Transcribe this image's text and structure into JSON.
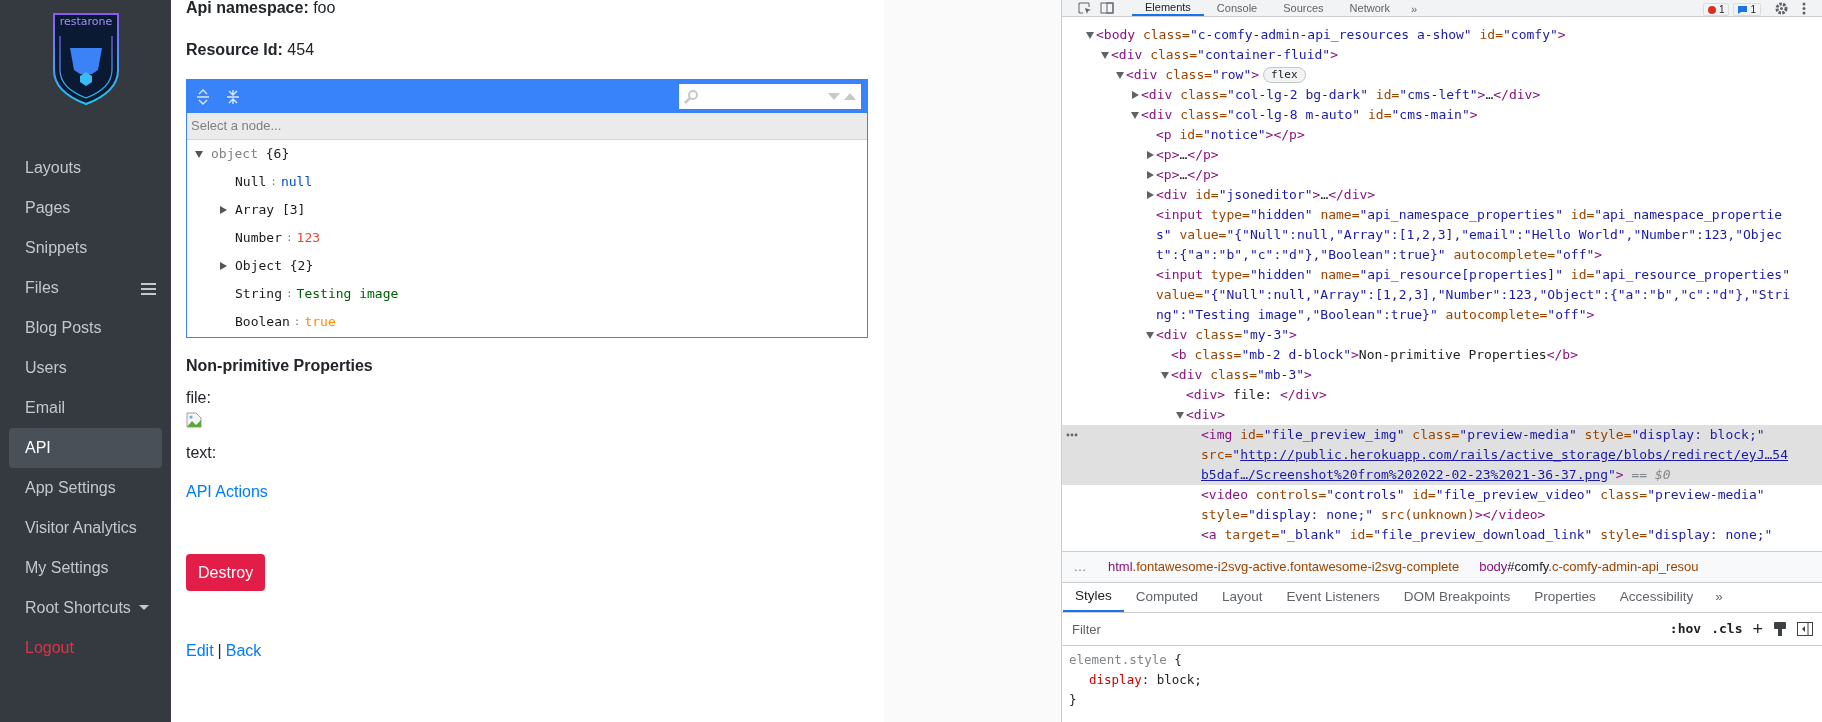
{
  "sidebar": {
    "logo_text": "restarone",
    "items": [
      {
        "label": "Layouts",
        "kind": "link",
        "selected": false
      },
      {
        "label": "Pages",
        "kind": "link",
        "selected": false
      },
      {
        "label": "Snippets",
        "kind": "link",
        "selected": false
      },
      {
        "label": "Files",
        "kind": "menu",
        "selected": false
      },
      {
        "label": "Blog Posts",
        "kind": "link",
        "selected": false
      },
      {
        "label": "Users",
        "kind": "link",
        "selected": false
      },
      {
        "label": "Email",
        "kind": "link",
        "selected": false
      },
      {
        "label": "API",
        "kind": "link",
        "selected": true
      },
      {
        "label": "App Settings",
        "kind": "link",
        "selected": false
      },
      {
        "label": "Visitor Analytics",
        "kind": "link",
        "selected": false
      },
      {
        "label": "My Settings",
        "kind": "link",
        "selected": false
      },
      {
        "label": "Root Shortcuts",
        "kind": "dropdown",
        "selected": false
      },
      {
        "label": "Logout",
        "kind": "danger",
        "selected": false
      }
    ]
  },
  "fields": [
    {
      "label": "Api namespace:",
      "value": "foo"
    },
    {
      "label": "Resource Id:",
      "value": "454"
    }
  ],
  "json_editor": {
    "navigation_text": "Select a node...",
    "separator": ":",
    "root": {
      "label": "object",
      "count": "{6}",
      "expanded": true
    },
    "nodes": [
      {
        "key": "Null",
        "kind": "null",
        "value": "null"
      },
      {
        "key": "Array",
        "kind": "array",
        "count": "[3]",
        "expanded": false
      },
      {
        "key": "Number",
        "kind": "number",
        "value": "123"
      },
      {
        "key": "Object",
        "kind": "object",
        "count": "{2}",
        "expanded": false
      },
      {
        "key": "String",
        "kind": "string",
        "value": "Testing image"
      },
      {
        "key": "Boolean",
        "kind": "boolean",
        "value": "true"
      }
    ]
  },
  "non_primitive": {
    "title": "Non-primitive Properties",
    "items": [
      {
        "label": "file:",
        "kind": "image"
      },
      {
        "label": "text:",
        "kind": "text"
      }
    ]
  },
  "actions_link": "API Actions",
  "destroy_button": "Destroy",
  "footer_links": [
    "Edit",
    "Back"
  ],
  "footer_separator": "|",
  "devtools": {
    "tabs": [
      {
        "label": "Elements",
        "selected": true
      },
      {
        "label": "Console",
        "selected": false
      },
      {
        "label": "Sources",
        "selected": false
      },
      {
        "label": "Network",
        "selected": false
      }
    ],
    "more_tabs": "»",
    "error_count": "1",
    "message_count": "1",
    "dom": [
      {
        "expanded": true,
        "selected": false,
        "lines": [
          [
            {
              "kind": "tag",
              "text": "<body"
            },
            {
              "kind": "attr",
              "text": " class="
            },
            {
              "kind": "val",
              "text": "\"c-comfy-admin-api_resources a-show\""
            },
            {
              "kind": "attr",
              "text": " id="
            },
            {
              "kind": "val",
              "text": "\"comfy\""
            },
            {
              "kind": "tag",
              "text": ">"
            }
          ]
        ],
        "children": [
          {
            "expanded": true,
            "selected": false,
            "lines": [
              [
                {
                  "kind": "tag",
                  "text": "<div"
                },
                {
                  "kind": "attr",
                  "text": " class="
                },
                {
                  "kind": "val",
                  "text": "\"container-fluid\""
                },
                {
                  "kind": "tag",
                  "text": ">"
                }
              ]
            ],
            "children": [
              {
                "expanded": true,
                "selected": false,
                "badge": "flex",
                "lines": [
                  [
                    {
                      "kind": "tag",
                      "text": "<div"
                    },
                    {
                      "kind": "attr",
                      "text": " class="
                    },
                    {
                      "kind": "val",
                      "text": "\"row\""
                    },
                    {
                      "kind": "tag",
                      "text": ">"
                    }
                  ]
                ],
                "children": [
                  {
                    "expanded": false,
                    "selected": false,
                    "lines": [
                      [
                        {
                          "kind": "tag",
                          "text": "<div"
                        },
                        {
                          "kind": "attr",
                          "text": " class="
                        },
                        {
                          "kind": "val",
                          "text": "\"col-lg-2 bg-dark\""
                        },
                        {
                          "kind": "attr",
                          "text": " id="
                        },
                        {
                          "kind": "val",
                          "text": "\"cms-left\""
                        },
                        {
                          "kind": "tag",
                          "text": ">"
                        },
                        {
                          "kind": "text",
                          "text": "…"
                        },
                        {
                          "kind": "tag",
                          "text": "</div>"
                        }
                      ]
                    ]
                  },
                  {
                    "expanded": true,
                    "selected": false,
                    "lines": [
                      [
                        {
                          "kind": "tag",
                          "text": "<div"
                        },
                        {
                          "kind": "attr",
                          "text": " class="
                        },
                        {
                          "kind": "val",
                          "text": "\"col-lg-8 m-auto\""
                        },
                        {
                          "kind": "attr",
                          "text": " id="
                        },
                        {
                          "kind": "val",
                          "text": "\"cms-main\""
                        },
                        {
                          "kind": "tag",
                          "text": ">"
                        }
                      ]
                    ],
                    "children": [
                      {
                        "selected": false,
                        "lines": [
                          [
                            {
                              "kind": "tag",
                              "text": "<p"
                            },
                            {
                              "kind": "attr",
                              "text": " id="
                            },
                            {
                              "kind": "val",
                              "text": "\"notice\""
                            },
                            {
                              "kind": "tag",
                              "text": "></p>"
                            }
                          ]
                        ]
                      },
                      {
                        "expanded": false,
                        "selected": false,
                        "lines": [
                          [
                            {
                              "kind": "tag",
                              "text": "<p>"
                            },
                            {
                              "kind": "text",
                              "text": "…"
                            },
                            {
                              "kind": "tag",
                              "text": "</p>"
                            }
                          ]
                        ]
                      },
                      {
                        "expanded": false,
                        "selected": false,
                        "lines": [
                          [
                            {
                              "kind": "tag",
                              "text": "<p>"
                            },
                            {
                              "kind": "text",
                              "text": "…"
                            },
                            {
                              "kind": "tag",
                              "text": "</p>"
                            }
                          ]
                        ]
                      },
                      {
                        "expanded": false,
                        "selected": false,
                        "lines": [
                          [
                            {
                              "kind": "tag",
                              "text": "<div"
                            },
                            {
                              "kind": "attr",
                              "text": " id="
                            },
                            {
                              "kind": "val",
                              "text": "\"jsoneditor\""
                            },
                            {
                              "kind": "tag",
                              "text": ">"
                            },
                            {
                              "kind": "text",
                              "text": "…"
                            },
                            {
                              "kind": "tag",
                              "text": "</div>"
                            }
                          ]
                        ]
                      },
                      {
                        "selected": false,
                        "lines": [
                          [
                            {
                              "kind": "tag",
                              "text": "<input"
                            },
                            {
                              "kind": "attr",
                              "text": " type="
                            },
                            {
                              "kind": "val",
                              "text": "\"hidden\""
                            },
                            {
                              "kind": "attr",
                              "text": " name="
                            },
                            {
                              "kind": "val",
                              "text": "\"api_namespace_properties\""
                            },
                            {
                              "kind": "attr",
                              "text": " id="
                            },
                            {
                              "kind": "val",
                              "text": "\"api_namespace_propertie"
                            }
                          ],
                          [
                            {
                              "kind": "val",
                              "text": "s\""
                            },
                            {
                              "kind": "attr",
                              "text": " value="
                            },
                            {
                              "kind": "val",
                              "text": "\"{\"Null\":null,\"Array\":[1,2,3],\"email\":\"Hello World\",\"Number\":123,\"Objec"
                            }
                          ],
                          [
                            {
                              "kind": "val",
                              "text": "t\":{\"a\":\"b\",\"c\":\"d\"},\"Boolean\":true}\""
                            },
                            {
                              "kind": "attr",
                              "text": " autocomplete="
                            },
                            {
                              "kind": "val",
                              "text": "\"off\""
                            },
                            {
                              "kind": "tag",
                              "text": ">"
                            }
                          ]
                        ]
                      },
                      {
                        "selected": false,
                        "lines": [
                          [
                            {
                              "kind": "tag",
                              "text": "<input"
                            },
                            {
                              "kind": "attr",
                              "text": " type="
                            },
                            {
                              "kind": "val",
                              "text": "\"hidden\""
                            },
                            {
                              "kind": "attr",
                              "text": " name="
                            },
                            {
                              "kind": "val",
                              "text": "\"api_resource[properties]\""
                            },
                            {
                              "kind": "attr",
                              "text": " id="
                            },
                            {
                              "kind": "val",
                              "text": "\"api_resource_properties\""
                            }
                          ],
                          [
                            {
                              "kind": "attr",
                              "text": "value="
                            },
                            {
                              "kind": "val",
                              "text": "\"{\"Null\":null,\"Array\":[1,2,3],\"Number\":123,\"Object\":{\"a\":\"b\",\"c\":\"d\"},\"Stri"
                            }
                          ],
                          [
                            {
                              "kind": "val",
                              "text": "ng\":\"Testing image\",\"Boolean\":true}\""
                            },
                            {
                              "kind": "attr",
                              "text": " autocomplete="
                            },
                            {
                              "kind": "val",
                              "text": "\"off\""
                            },
                            {
                              "kind": "tag",
                              "text": ">"
                            }
                          ]
                        ]
                      },
                      {
                        "expanded": true,
                        "selected": false,
                        "lines": [
                          [
                            {
                              "kind": "tag",
                              "text": "<div"
                            },
                            {
                              "kind": "attr",
                              "text": " class="
                            },
                            {
                              "kind": "val",
                              "text": "\"my-3\""
                            },
                            {
                              "kind": "tag",
                              "text": ">"
                            }
                          ]
                        ],
                        "children": [
                          {
                            "selected": false,
                            "lines": [
                              [
                                {
                                  "kind": "tag",
                                  "text": "<b"
                                },
                                {
                                  "kind": "attr",
                                  "text": " class="
                                },
                                {
                                  "kind": "val",
                                  "text": "\"mb-2 d-block\""
                                },
                                {
                                  "kind": "tag",
                                  "text": ">"
                                },
                                {
                                  "kind": "text",
                                  "text": "Non-primitive Properties"
                                },
                                {
                                  "kind": "tag",
                                  "text": "</b>"
                                }
                              ]
                            ]
                          },
                          {
                            "expanded": true,
                            "selected": false,
                            "lines": [
                              [
                                {
                                  "kind": "tag",
                                  "text": "<div"
                                },
                                {
                                  "kind": "attr",
                                  "text": " class="
                                },
                                {
                                  "kind": "val",
                                  "text": "\"mb-3\""
                                },
                                {
                                  "kind": "tag",
                                  "text": ">"
                                }
                              ]
                            ],
                            "children": [
                              {
                                "selected": false,
                                "lines": [
                                  [
                                    {
                                      "kind": "tag",
                                      "text": "<div>"
                                    },
                                    {
                                      "kind": "text",
                                      "text": " file: "
                                    },
                                    {
                                      "kind": "tag",
                                      "text": "</div>"
                                    }
                                  ]
                                ]
                              },
                              {
                                "expanded": true,
                                "selected": false,
                                "lines": [
                                  [
                                    {
                                      "kind": "tag",
                                      "text": "<div>"
                                    }
                                  ]
                                ],
                                "children": [
                                  {
                                    "selected": true,
                                    "lines": [
                                      [
                                        {
                                          "kind": "tag",
                                          "text": "<img"
                                        },
                                        {
                                          "kind": "attr",
                                          "text": " id="
                                        },
                                        {
                                          "kind": "val",
                                          "text": "\"file_preview_img\""
                                        },
                                        {
                                          "kind": "attr",
                                          "text": " class="
                                        },
                                        {
                                          "kind": "val",
                                          "text": "\"preview-media\""
                                        },
                                        {
                                          "kind": "attr",
                                          "text": " style="
                                        },
                                        {
                                          "kind": "val",
                                          "text": "\"display: block;\""
                                        }
                                      ],
                                      [
                                        {
                                          "kind": "attr",
                                          "text": "src="
                                        },
                                        {
                                          "kind": "val",
                                          "text": "\""
                                        },
                                        {
                                          "kind": "link",
                                          "text": "http://public.herokuapp.com/rails/active_storage/blobs/redirect/eyJ…54"
                                        }
                                      ],
                                      [
                                        {
                                          "kind": "link",
                                          "text": "b5daf…/Screenshot%20from%202022-02-23%2021-36-37.png"
                                        },
                                        {
                                          "kind": "val",
                                          "text": "\""
                                        },
                                        {
                                          "kind": "tag",
                                          "text": ">"
                                        },
                                        {
                                          "kind": "dim",
                                          "text": " == $0"
                                        }
                                      ]
                                    ]
                                  },
                                  {
                                    "selected": false,
                                    "lines": [
                                      [
                                        {
                                          "kind": "tag",
                                          "text": "<video"
                                        },
                                        {
                                          "kind": "attr",
                                          "text": " controls="
                                        },
                                        {
                                          "kind": "val",
                                          "text": "\"controls\""
                                        },
                                        {
                                          "kind": "attr",
                                          "text": " id="
                                        },
                                        {
                                          "kind": "val",
                                          "text": "\"file_preview_video\""
                                        },
                                        {
                                          "kind": "attr",
                                          "text": " class="
                                        },
                                        {
                                          "kind": "val",
                                          "text": "\"preview-media\""
                                        }
                                      ],
                                      [
                                        {
                                          "kind": "attr",
                                          "text": "style="
                                        },
                                        {
                                          "kind": "val",
                                          "text": "\"display: none;\""
                                        },
                                        {
                                          "kind": "attr",
                                          "text": " src(unknown)"
                                        },
                                        {
                                          "kind": "tag",
                                          "text": "></video>"
                                        }
                                      ]
                                    ]
                                  },
                                  {
                                    "selected": false,
                                    "lines": [
                                      [
                                        {
                                          "kind": "tag",
                                          "text": "<a"
                                        },
                                        {
                                          "kind": "attr",
                                          "text": " target="
                                        },
                                        {
                                          "kind": "val",
                                          "text": "\"_blank\""
                                        },
                                        {
                                          "kind": "attr",
                                          "text": " id="
                                        },
                                        {
                                          "kind": "val",
                                          "text": "\"file_preview_download_link\""
                                        },
                                        {
                                          "kind": "attr",
                                          "text": " style="
                                        },
                                        {
                                          "kind": "val",
                                          "text": "\"display: none;\""
                                        }
                                      ]
                                    ]
                                  }
                                ]
                              }
                            ]
                          }
                        ]
                      }
                    ]
                  }
                ]
              }
            ]
          }
        ]
      }
    ],
    "breadcrumbs": {
      "more": "…",
      "items": [
        [
          {
            "kind": "tag",
            "text": "html"
          },
          {
            "kind": "cls",
            "text": ".fontawesome-i2svg-active.fontawesome-i2svg-complete"
          }
        ],
        [
          {
            "kind": "tag",
            "text": "body"
          },
          {
            "kind": "id",
            "text": "#comfy"
          },
          {
            "kind": "cls",
            "text": ".c-comfy-admin-api_resou"
          }
        ]
      ]
    },
    "panel_tabs": [
      {
        "label": "Styles",
        "selected": true
      },
      {
        "label": "Computed",
        "selected": false
      },
      {
        "label": "Layout",
        "selected": false
      },
      {
        "label": "Event Listeners",
        "selected": false
      },
      {
        "label": "DOM Breakpoints",
        "selected": false
      },
      {
        "label": "Properties",
        "selected": false
      },
      {
        "label": "Accessibility",
        "selected": false
      }
    ],
    "panel_more": "»",
    "filter_placeholder": "Filter",
    "hov": ":hov",
    "cls": ".cls",
    "plus": "+",
    "style_rule": {
      "selector": "element.style",
      "open": "{",
      "property": "display",
      "separator": ":",
      "value": "block;",
      "close": "}"
    }
  }
}
